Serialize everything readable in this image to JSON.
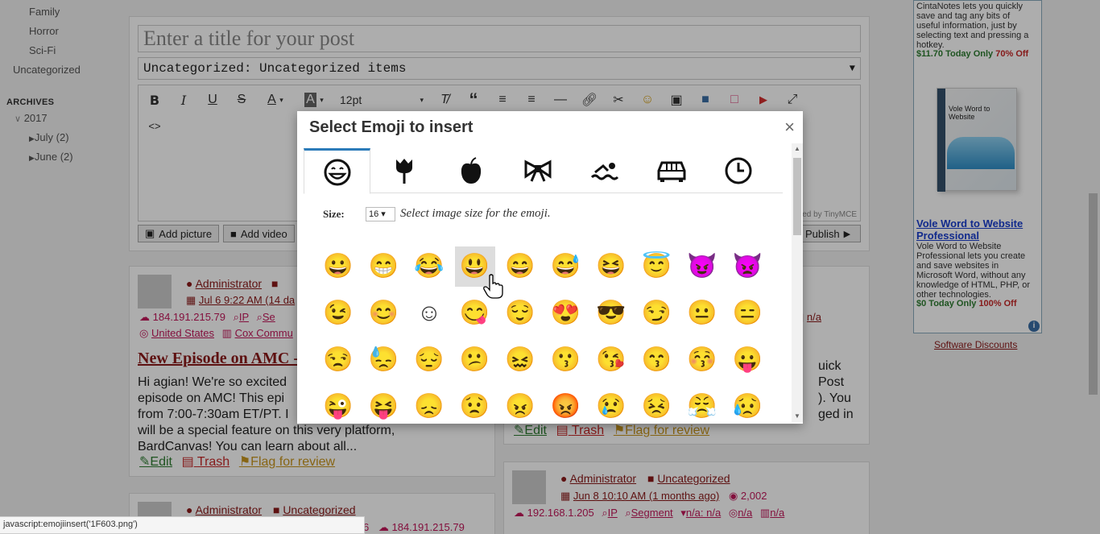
{
  "sidebar": {
    "categories": [
      "Family",
      "Horror",
      "Sci-Fi",
      "Uncategorized"
    ],
    "archives_heading": "ARCHIVES",
    "year": "2017",
    "months": [
      "July (2)",
      "June (2)"
    ]
  },
  "composer": {
    "title_placeholder": "Enter a title for your post",
    "category": "Uncategorized: Uncategorized items",
    "font_size": "12pt",
    "powered": "ered by TinyMCE",
    "add_picture": "Add picture",
    "add_video": "Add video",
    "publish": "Publish"
  },
  "posts": {
    "p1": {
      "author": "Administrator",
      "date": "Jul 6 9:22 AM (14 da",
      "ip": "184.191.215.79",
      "ip_link": "IP",
      "seg": "Se",
      "country": "United States",
      "isp": "Cox Commu",
      "title": "New Episode on AMC -",
      "excerpt": [
        "Hi agian! We're so excited",
        "episode on AMC! This epi",
        "from 7:00-7:30am ET/PT. I",
        "will be a special feature on this very platform,",
        "BardCanvas! You can learn about all..."
      ],
      "edit": "Edit",
      "trash": "Trash",
      "flag": "Flag for review"
    },
    "p2": {
      "na": "n/a",
      "excerpt": [
        "uick Post",
        "). You",
        "ged in"
      ],
      "edit": "Edit",
      "trash": "Trash",
      "flag": "Flag for review"
    },
    "p3": {
      "author": "Administrator",
      "category": "Uncategorized",
      "date": "Jun 8 10:10 AM (1 months ago)",
      "views": "2,002",
      "ip": "192.168.1.205",
      "ip_link": "IP",
      "segment": "Segment",
      "location": "n/a: n/a",
      "na1": "n/a",
      "na2": "n/a"
    },
    "p4": {
      "author": "Administrator",
      "category": "Uncategorized",
      "ip": "184.191.215.79",
      "date_tail": "6"
    }
  },
  "ad": {
    "intro": [
      "CintaNotes lets you quickly",
      "save and tag any bits of",
      "useful information, just by",
      "selecting text and pressing a",
      "hotkey."
    ],
    "deal1_price": "$11.70 Today Only",
    "deal1_off": "70% Off",
    "box_label": "Vole Word to Website",
    "product_title": [
      "Vole Word to Website",
      "Professional"
    ],
    "product_desc": [
      "Vole Word to Website",
      "Professional lets you create",
      "and save websites in",
      "Microsoft Word, without any",
      "knowledge of HTML, PHP, or",
      "other technologies."
    ],
    "deal2_price": "$0 Today Only",
    "deal2_off": "100% Off",
    "footer_link": "Software Discounts"
  },
  "dialog": {
    "title": "Select Emoji to insert",
    "close": "×",
    "tabs": [
      "smileys-icon",
      "flower-icon",
      "apple-icon",
      "bow-icon",
      "swimmer-icon",
      "car-icon",
      "clock-icon"
    ],
    "size_label": "Size:",
    "size_value": "16 ▾",
    "size_help": "Select image size for the emoji.",
    "emoji_rows": [
      [
        "😀",
        "😁",
        "😂",
        "😃",
        "😄",
        "😅",
        "😆",
        "😇",
        "😈",
        "👿"
      ],
      [
        "😉",
        "😊",
        "☺",
        "😋",
        "😌",
        "😍",
        "😎",
        "😏",
        "😐",
        "😑"
      ],
      [
        "😒",
        "😓",
        "😔",
        "😕",
        "😖",
        "😗",
        "😘",
        "😙",
        "😚",
        "😛"
      ],
      [
        "😜",
        "😝",
        "😞",
        "😟",
        "😠",
        "😡",
        "😢",
        "😣",
        "😤",
        "😥"
      ]
    ]
  },
  "status_bar": "javascript:emojiinsert('1F603.png')"
}
